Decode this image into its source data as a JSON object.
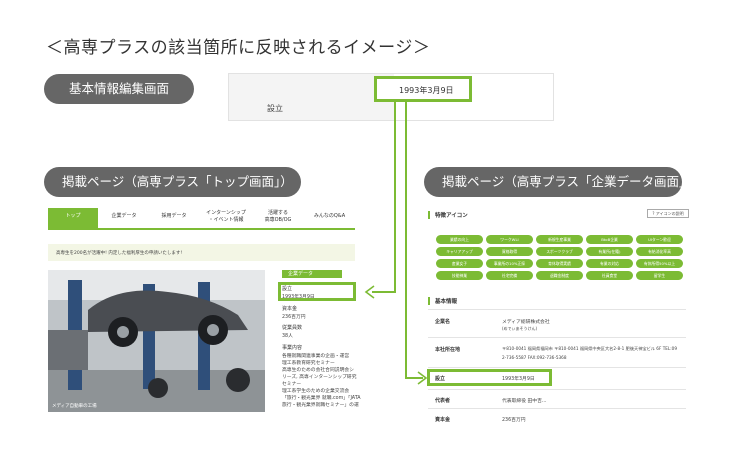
{
  "heading": "＜高専プラスの該当箇所に反映されるイメージ＞",
  "pills": {
    "basic_edit": "基本情報編集画面",
    "top_page": "掲載ページ（高専プラス「トップ画面」）",
    "company_page": "掲載ページ（高専プラス「企業データ画面」）"
  },
  "edit_form": {
    "label": "設立",
    "value": "1993年3月9日"
  },
  "top_page": {
    "nav": [
      "トップ",
      "企業データ",
      "採用データ",
      "インターンシップ\n・イベント情報",
      "活躍する\n高専OB/OG",
      "みんなのQ&A"
    ],
    "notice": "高専生を200名が活躍中! 内定した福利厚生の申請いたします!",
    "photo_caption": "メディア自動車の工場",
    "side_title": "企業データ",
    "founded_label": "設立",
    "founded_value": "1993年3月9日",
    "capital_label": "資本金",
    "capital_value": "236百万円",
    "employees_label": "従業員数",
    "employees_value": "38人",
    "business_label": "事業内容",
    "business_lines": [
      "各種就職関連事業の企画・運営",
      "理工系教育研究セミナー",
      "高専生のための会社合同説明会シ",
      "リーズ, 高専インターンシップ研究",
      "セミナー",
      "理工系学生のための企業交流会",
      "「旅行・観光業界 就職.com」「JATA",
      "旅行・観光業界就職セミナー」の運"
    ]
  },
  "company_page": {
    "feature_title": "特徴アイコン",
    "icon_legend_button": "? アイコンの説明",
    "tags": [
      "業績の向上",
      "ワークWLI",
      "新規生産事業",
      "BtoB企業",
      "UIターン歓迎",
      "キャリアアップ",
      "資格取得",
      "スポーツクラブ",
      "有業所(在籍)",
      "有給消化率高",
      "産業女子",
      "事業所の10%正採",
      "育休取得実績",
      "有業の対応",
      "有休所得50%以上",
      "技能神業",
      "社宅完備",
      "退職金制度",
      "社員食堂",
      "留学生"
    ],
    "basic_title": "基本情報",
    "rows": [
      {
        "label": "企業名",
        "value": "メディア総研株式会社",
        "sub": "(めでぃあそうけん)"
      },
      {
        "label": "本社所在地",
        "value": "〒810-0041 福岡県福岡市 〒810-0041 福岡県中央区大名2-8-1 肥後天神宝ビル 6F TEL:09",
        "sub": "2-736-5587  FAX:092-736-5368"
      },
      {
        "label": "設立",
        "value": "1993年3月9日",
        "sub": ""
      },
      {
        "label": "代表者",
        "value": "代表取締役  田中吉...",
        "sub": ""
      },
      {
        "label": "資本金",
        "value": "236百万円",
        "sub": ""
      }
    ]
  },
  "colors": {
    "accent": "#7cbb34",
    "pill": "#666666"
  }
}
